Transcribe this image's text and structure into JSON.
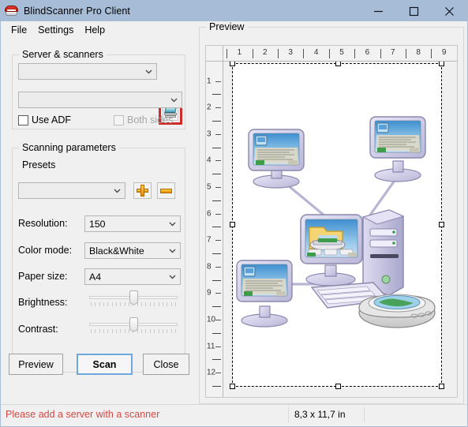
{
  "window": {
    "title": "BlindScanner Pro Client",
    "icon": "scanner-app-icon",
    "controls": {
      "minimize": "minimize-icon",
      "maximize": "maximize-icon",
      "close": "close-icon"
    }
  },
  "menubar": {
    "items": [
      {
        "label": "File"
      },
      {
        "label": "Settings"
      },
      {
        "label": "Help"
      }
    ]
  },
  "server_group": {
    "title": "Server & scanners",
    "server_combo": {
      "value": "",
      "placeholder": ""
    },
    "scanner_combo": {
      "value": "",
      "placeholder": ""
    },
    "scanner_button": {
      "icon": "scanner-icon",
      "highlight_color": "#cf2b2b"
    },
    "use_adf": {
      "label": "Use ADF",
      "checked": false,
      "enabled": true
    },
    "both_sides": {
      "label": "Both sides",
      "checked": false,
      "enabled": false
    }
  },
  "params_group": {
    "title": "Scanning parameters",
    "presets_label": "Presets",
    "presets_combo": {
      "value": ""
    },
    "add_preset_button": {
      "icon": "plus-icon"
    },
    "remove_preset_button": {
      "icon": "minus-icon"
    },
    "fields": [
      {
        "label": "Resolution:",
        "value": "150"
      },
      {
        "label": "Color mode:",
        "value": "Black&White"
      },
      {
        "label": "Paper size:",
        "value": "A4"
      }
    ],
    "sliders": [
      {
        "label": "Brightness:",
        "percent": 50
      },
      {
        "label": "Contrast:",
        "percent": 50
      }
    ]
  },
  "actions": {
    "preview": "Preview",
    "scan": "Scan",
    "close": "Close"
  },
  "preview": {
    "title": "Preview",
    "ruler_h": {
      "labels": [
        "1",
        "2",
        "3",
        "4",
        "5",
        "6",
        "7",
        "8",
        "9"
      ],
      "unit": "in"
    },
    "ruler_v": {
      "labels": [
        "1",
        "2",
        "3",
        "4",
        "5",
        "6",
        "7",
        "8",
        "9",
        "10",
        "11",
        "12"
      ],
      "unit": "in"
    },
    "artwork": "network-computers-scanner-illustration"
  },
  "statusbar": {
    "message": "Please add a server with a scanner",
    "message_color": "#d24a46",
    "page_size": "8,3 x 11,7 in"
  },
  "chart_data": null
}
